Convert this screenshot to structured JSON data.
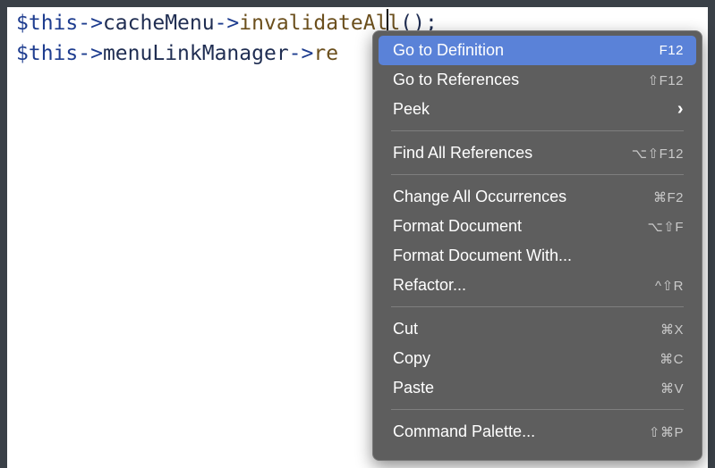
{
  "editor": {
    "line1": {
      "var": "$this",
      "arrow1": "->",
      "prop": "cacheMenu",
      "arrow2": "->",
      "method": "invalidateAll",
      "tail": "();"
    },
    "line2": {
      "var": "$this",
      "arrow1": "->",
      "prop": "menuLinkManager",
      "arrow2": "->",
      "method": "re"
    }
  },
  "context_menu": {
    "groups": [
      [
        {
          "label": "Go to Definition",
          "shortcut": "F12",
          "active": true
        },
        {
          "label": "Go to References",
          "shortcut": "⇧F12"
        },
        {
          "label": "Peek",
          "shortcut": "›",
          "submenu": true
        }
      ],
      [
        {
          "label": "Find All References",
          "shortcut": "⌥⇧F12"
        }
      ],
      [
        {
          "label": "Change All Occurrences",
          "shortcut": "⌘F2"
        },
        {
          "label": "Format Document",
          "shortcut": "⌥⇧F"
        },
        {
          "label": "Format Document With...",
          "shortcut": ""
        },
        {
          "label": "Refactor...",
          "shortcut": "^⇧R"
        }
      ],
      [
        {
          "label": "Cut",
          "shortcut": "⌘X"
        },
        {
          "label": "Copy",
          "shortcut": "⌘C"
        },
        {
          "label": "Paste",
          "shortcut": "⌘V"
        }
      ],
      [
        {
          "label": "Command Palette...",
          "shortcut": "⇧⌘P"
        }
      ]
    ]
  },
  "colors": {
    "menu_bg": "#5e5e5e",
    "highlight": "#5a82d8",
    "frame": "#3a4047"
  }
}
